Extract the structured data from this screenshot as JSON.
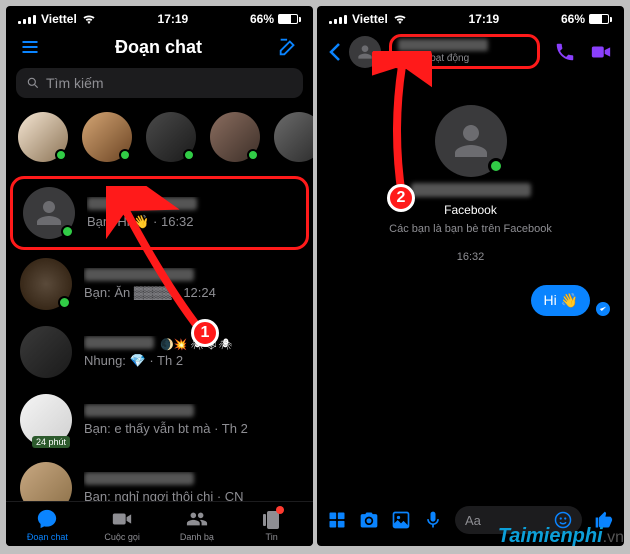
{
  "status": {
    "carrier": "Viettel",
    "time": "17:19",
    "battery_pct": "66%"
  },
  "left": {
    "title": "Đoạn chat",
    "search_placeholder": "Tìm kiếm",
    "chats": [
      {
        "preview": "Bạn: Hi 👋 · 16:32"
      },
      {
        "preview": "Bạn: Ăn ▓▓▓▓ · 12:24"
      },
      {
        "preview": "Nhung: 💎 · Th 2",
        "extra": "🌒💥 🕷🕸🕷"
      },
      {
        "preview": "Bạn: e thấy vẫn bt mà · Th 2",
        "badge": "24 phút"
      },
      {
        "preview": "Bạn: nghỉ ngơi thôi chị · CN"
      }
    ],
    "nav": {
      "chat": "Đoạn chat",
      "call": "Cuộc gọi",
      "contacts": "Danh bạ",
      "news": "Tin"
    }
  },
  "right": {
    "status_text": "Đang hoạt động",
    "platform": "Facebook",
    "friend_note": "Các bạn là bạn bè trên Facebook",
    "timestamp": "16:32",
    "message": "Hi 👋",
    "input_placeholder": "Aa"
  },
  "callouts": {
    "c1": "1",
    "c2": "2"
  },
  "watermark": {
    "brand": "Taimienphi",
    "tld": ".vn"
  }
}
